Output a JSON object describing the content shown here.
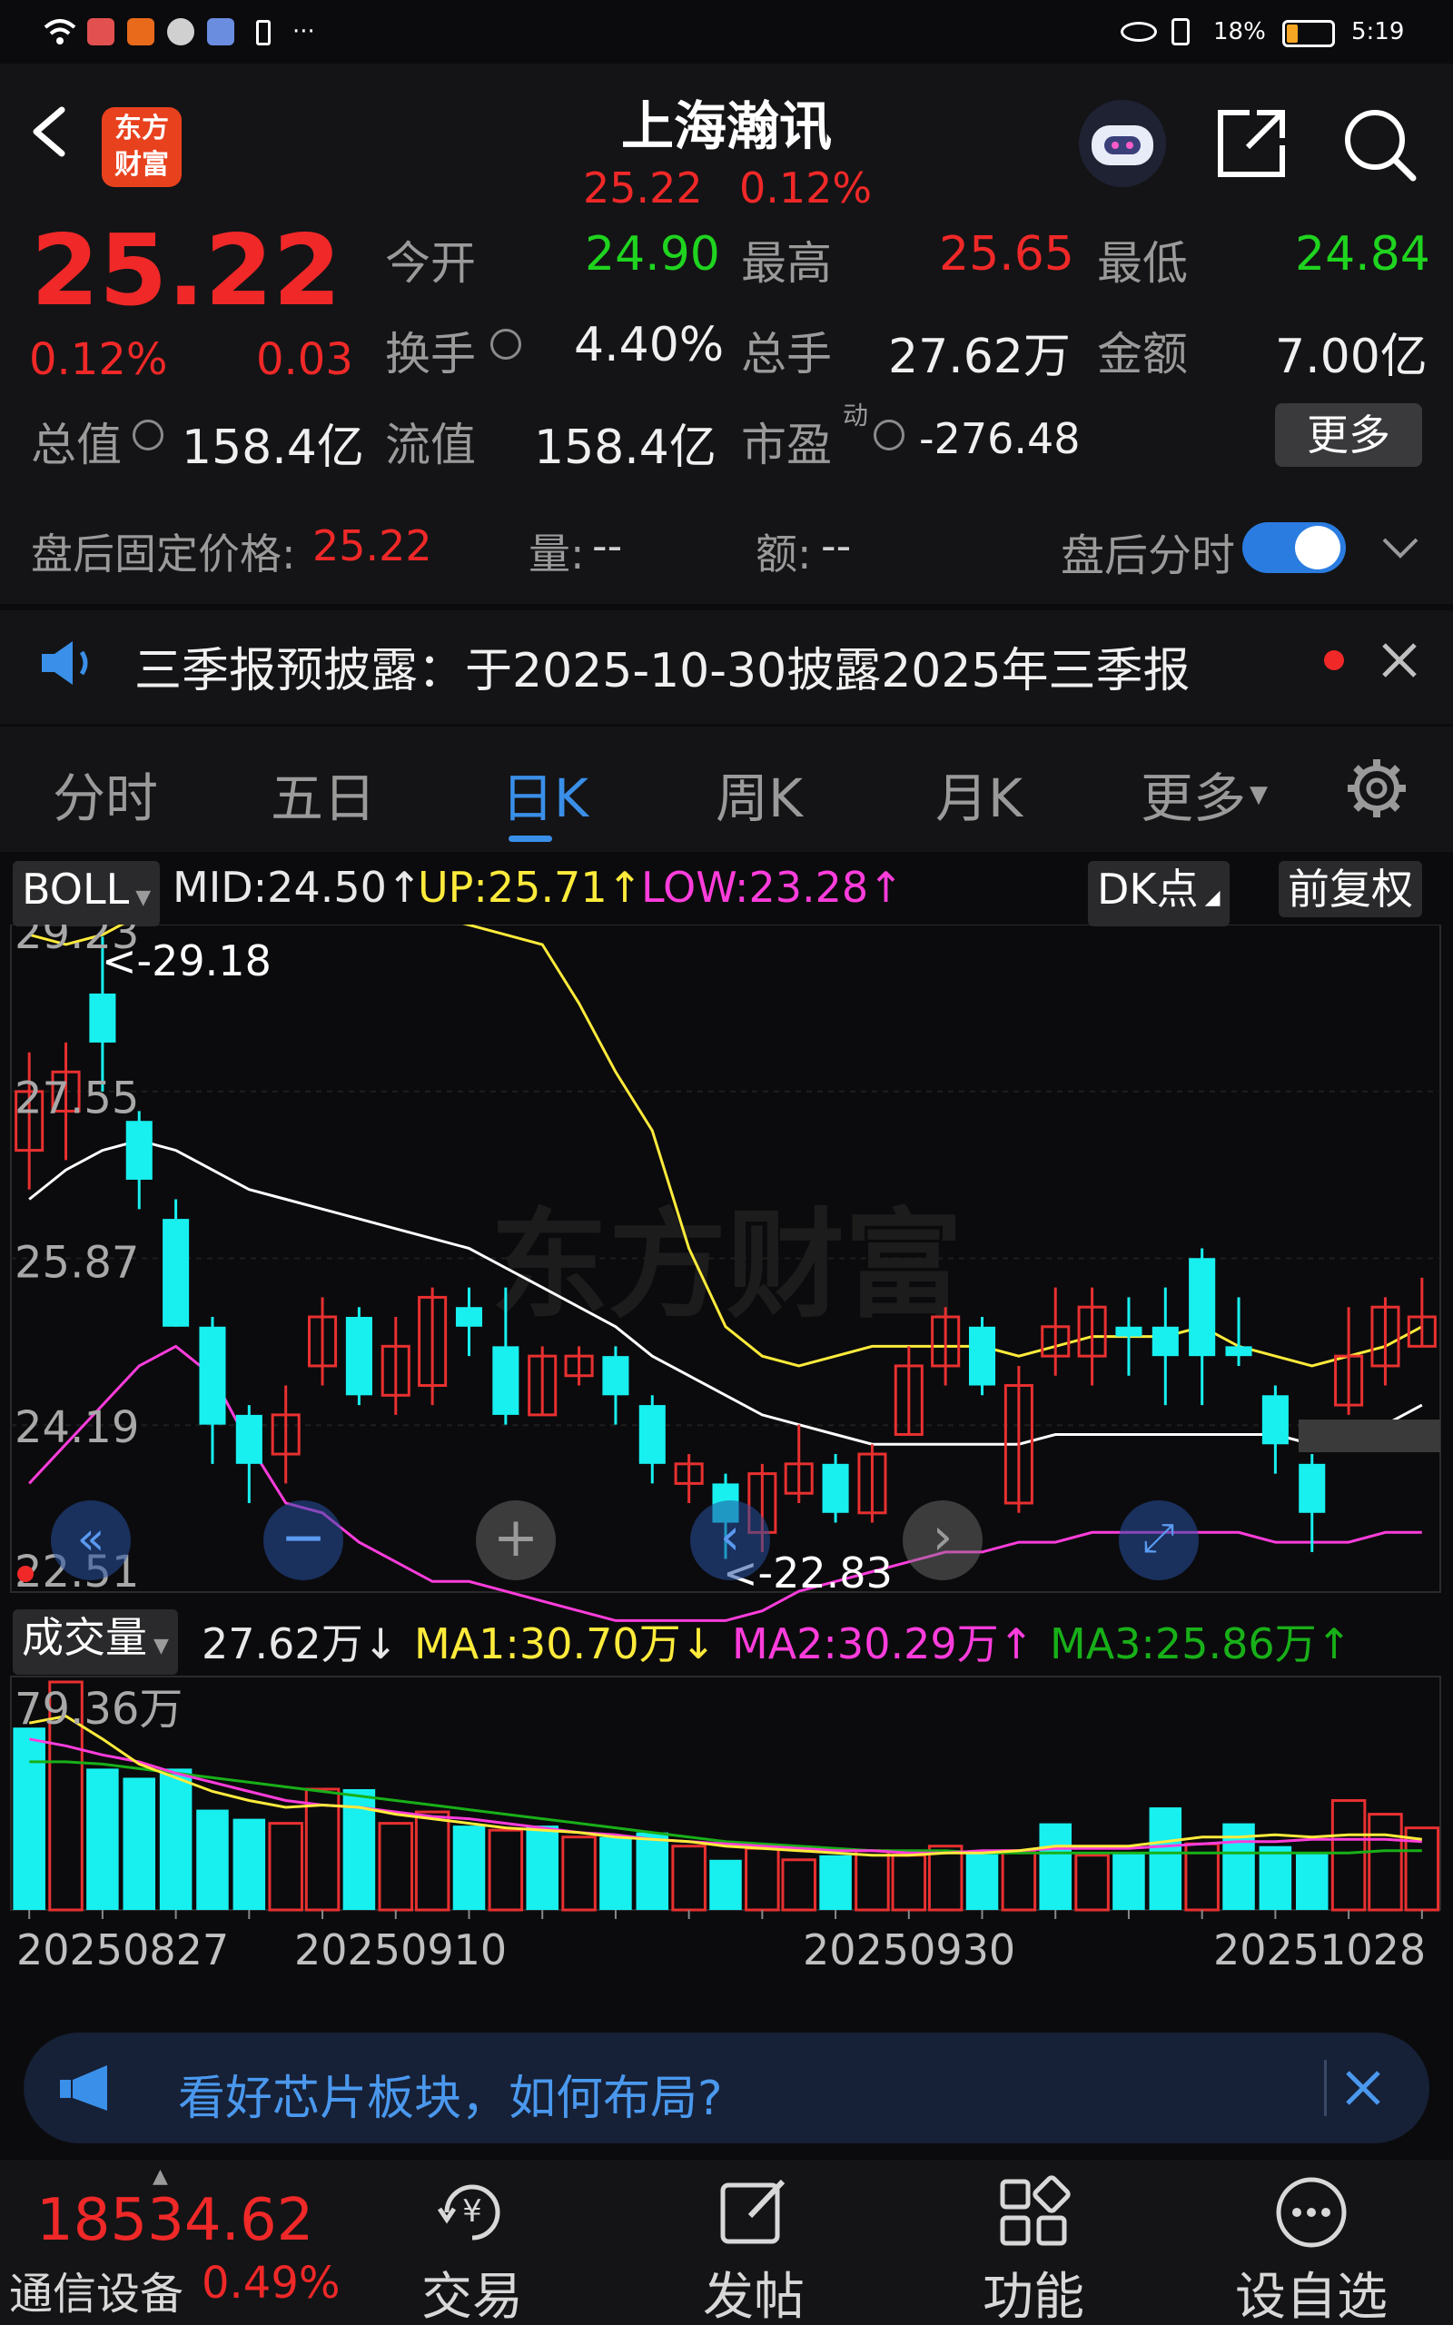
{
  "status_bar": {
    "battery": "18%",
    "time": "5:19"
  },
  "header": {
    "logo_text": "东方财富",
    "title": "上海瀚讯",
    "sub_price": "25.22",
    "sub_pct": "0.12%"
  },
  "quote": {
    "price": "25.22",
    "pct": "0.12%",
    "change": "0.03",
    "open_label": "今开",
    "open": "24.90",
    "high_label": "最高",
    "high": "25.65",
    "low_label": "最低",
    "low": "24.84",
    "turnover_label": "换手",
    "turnover": "4.40%",
    "volume_label": "总手",
    "volume": "27.62万",
    "amount_label": "金额",
    "amount": "7.00亿",
    "mcap_label": "总值",
    "mcap": "158.4亿",
    "float_label": "流值",
    "float": "158.4亿",
    "pe_label": "市盈",
    "pe_sup": "动",
    "pe": "-276.48",
    "more_label": "更多"
  },
  "after_hours": {
    "fixed_label": "盘后固定价格:",
    "fixed_value": "25.22",
    "vol_label": "量:",
    "vol_value": "--",
    "amt_label": "额:",
    "amt_value": "--",
    "intraday_label": "盘后分时"
  },
  "notice": {
    "text": "三季报预披露：于2025-10-30披露2025年三季报"
  },
  "tabs": [
    "分时",
    "五日",
    "日K",
    "周K",
    "月K",
    "更多"
  ],
  "active_tab": "日K",
  "boll": {
    "name": "BOLL",
    "mid": "MID:24.50↑",
    "up": "UP:25.71↑",
    "low": "LOW:23.28↑",
    "dk": "DK点",
    "adjust": "前复权"
  },
  "volume_ind": {
    "name": "成交量",
    "value": "27.62万↓",
    "ma1": "MA1:30.70万↓",
    "ma2": "MA2:30.29万↑",
    "ma3": "MA3:25.86万↑"
  },
  "chart_data": {
    "type": "candlestick",
    "price_axis": [
      "29.23",
      "27.55",
      "25.87",
      "24.19",
      "22.51"
    ],
    "ylim": [
      22.51,
      29.23
    ],
    "max_marker": "<-29.18",
    "min_marker": "<-22.83",
    "volume_axis": [
      "79.36万"
    ],
    "dates": [
      "20250827",
      "20250910",
      "20250930",
      "20251028"
    ],
    "candles": [
      [
        27.0,
        27.6,
        28.0,
        26.6
      ],
      [
        27.4,
        27.8,
        28.1,
        26.9
      ],
      [
        28.6,
        28.1,
        29.18,
        27.6
      ],
      [
        27.3,
        26.7,
        27.4,
        26.4
      ],
      [
        26.3,
        25.2,
        26.5,
        25.2
      ],
      [
        25.2,
        24.2,
        25.3,
        23.8
      ],
      [
        24.3,
        23.8,
        24.4,
        23.4
      ],
      [
        23.9,
        24.3,
        24.6,
        23.6
      ],
      [
        24.8,
        25.3,
        25.5,
        24.6
      ],
      [
        25.3,
        24.5,
        25.4,
        24.4
      ],
      [
        24.5,
        25.0,
        25.3,
        24.3
      ],
      [
        24.6,
        25.5,
        25.6,
        24.4
      ],
      [
        25.4,
        25.2,
        25.6,
        24.9
      ],
      [
        25.0,
        24.3,
        25.6,
        24.2
      ],
      [
        24.3,
        24.9,
        25.0,
        24.3
      ],
      [
        24.7,
        24.9,
        25.0,
        24.6
      ],
      [
        24.9,
        24.5,
        25.0,
        24.2
      ],
      [
        24.4,
        23.8,
        24.5,
        23.6
      ],
      [
        23.6,
        23.8,
        23.9,
        23.4
      ],
      [
        23.6,
        23.2,
        23.7,
        22.83
      ],
      [
        23.1,
        23.7,
        23.8,
        22.9
      ],
      [
        23.5,
        23.8,
        24.2,
        23.4
      ],
      [
        23.8,
        23.3,
        23.9,
        23.2
      ],
      [
        23.3,
        23.9,
        24.0,
        23.2
      ],
      [
        24.1,
        24.8,
        25.0,
        24.1
      ],
      [
        24.8,
        25.3,
        25.4,
        24.6
      ],
      [
        25.2,
        24.6,
        25.3,
        24.5
      ],
      [
        23.4,
        24.6,
        24.8,
        23.3
      ],
      [
        24.9,
        25.2,
        25.6,
        24.7
      ],
      [
        24.9,
        25.4,
        25.6,
        24.6
      ],
      [
        25.2,
        25.1,
        25.5,
        24.7
      ],
      [
        25.2,
        24.9,
        25.6,
        24.4
      ],
      [
        25.9,
        24.9,
        26.0,
        24.4
      ],
      [
        25.0,
        24.9,
        25.5,
        24.8
      ],
      [
        24.5,
        24.0,
        24.6,
        23.7
      ],
      [
        23.8,
        23.3,
        23.9,
        22.9
      ],
      [
        24.4,
        24.9,
        25.4,
        24.3
      ],
      [
        24.8,
        25.4,
        25.5,
        24.6
      ],
      [
        25.0,
        25.3,
        25.7,
        25.0
      ]
    ],
    "boll_mid": [
      26.5,
      26.8,
      27.0,
      27.1,
      27.0,
      26.8,
      26.6,
      26.5,
      26.4,
      26.3,
      26.2,
      26.1,
      26.0,
      25.8,
      25.6,
      25.4,
      25.2,
      24.9,
      24.7,
      24.5,
      24.3,
      24.2,
      24.1,
      24.0,
      24.0,
      24.0,
      24.0,
      24.0,
      24.1,
      24.1,
      24.1,
      24.1,
      24.1,
      24.1,
      24.1,
      24.0,
      24.1,
      24.2,
      24.4
    ],
    "boll_up": [
      29.2,
      29.1,
      29.2,
      29.4,
      29.4,
      29.4,
      29.4,
      29.4,
      29.4,
      29.4,
      29.4,
      29.4,
      29.3,
      29.2,
      29.1,
      28.5,
      27.8,
      27.2,
      26.0,
      25.2,
      24.9,
      24.8,
      24.9,
      25.0,
      25.0,
      25.0,
      25.0,
      24.9,
      25.0,
      25.1,
      25.1,
      25.1,
      25.2,
      25.0,
      24.9,
      24.8,
      24.9,
      25.0,
      25.2
    ],
    "boll_low": [
      23.6,
      24.0,
      24.4,
      24.8,
      25.0,
      24.7,
      24.0,
      23.4,
      23.3,
      23.0,
      22.8,
      22.6,
      22.6,
      22.5,
      22.4,
      22.3,
      22.2,
      22.2,
      22.2,
      22.2,
      22.3,
      22.5,
      22.6,
      22.7,
      22.8,
      22.9,
      22.9,
      23.0,
      23.0,
      23.1,
      23.1,
      23.1,
      23.1,
      23.1,
      23.0,
      23.0,
      23.0,
      23.1,
      23.1
    ],
    "volumes": [
      80,
      100,
      62,
      58,
      62,
      44,
      40,
      38,
      53,
      53,
      38,
      43,
      37,
      35,
      37,
      32,
      32,
      34,
      28,
      22,
      27,
      22,
      24,
      26,
      24,
      28,
      25,
      26,
      38,
      24,
      25,
      45,
      29,
      38,
      28,
      25,
      48,
      42,
      36
    ],
    "vol_up": [
      0,
      1,
      0,
      0,
      0,
      0,
      0,
      1,
      1,
      0,
      1,
      1,
      0,
      1,
      0,
      1,
      0,
      0,
      1,
      0,
      1,
      1,
      0,
      1,
      1,
      1,
      0,
      1,
      0,
      1,
      0,
      0,
      1,
      0,
      0,
      0,
      1,
      1,
      1
    ],
    "ma1": [
      82,
      85,
      75,
      64,
      58,
      52,
      48,
      45,
      46,
      45,
      42,
      40,
      38,
      36,
      35,
      34,
      32,
      31,
      30,
      28,
      27,
      26,
      25,
      24,
      24,
      25,
      25,
      26,
      28,
      28,
      28,
      30,
      32,
      32,
      33,
      32,
      33,
      33,
      31
    ],
    "ma2": [
      75,
      72,
      68,
      65,
      60,
      56,
      52,
      48,
      46,
      45,
      43,
      41,
      40,
      38,
      36,
      34,
      33,
      31,
      30,
      29,
      28,
      27,
      26,
      26,
      25,
      25,
      26,
      26,
      27,
      27,
      27,
      28,
      29,
      30,
      30,
      31,
      31,
      31,
      30
    ],
    "ma3": [
      65,
      65,
      64,
      62,
      60,
      58,
      56,
      54,
      52,
      50,
      48,
      46,
      44,
      42,
      40,
      38,
      36,
      34,
      32,
      30,
      29,
      28,
      27,
      26,
      26,
      26,
      25,
      25,
      25,
      25,
      25,
      25,
      25,
      25,
      25,
      25,
      25,
      26,
      26
    ]
  },
  "ad": {
    "text": "看好芯片板块，如何布局?"
  },
  "bottom": {
    "index_value": "18534.62",
    "index_name": "通信设备",
    "index_pct": "0.49%",
    "nav": [
      "交易",
      "发帖",
      "功能",
      "设自选"
    ]
  }
}
